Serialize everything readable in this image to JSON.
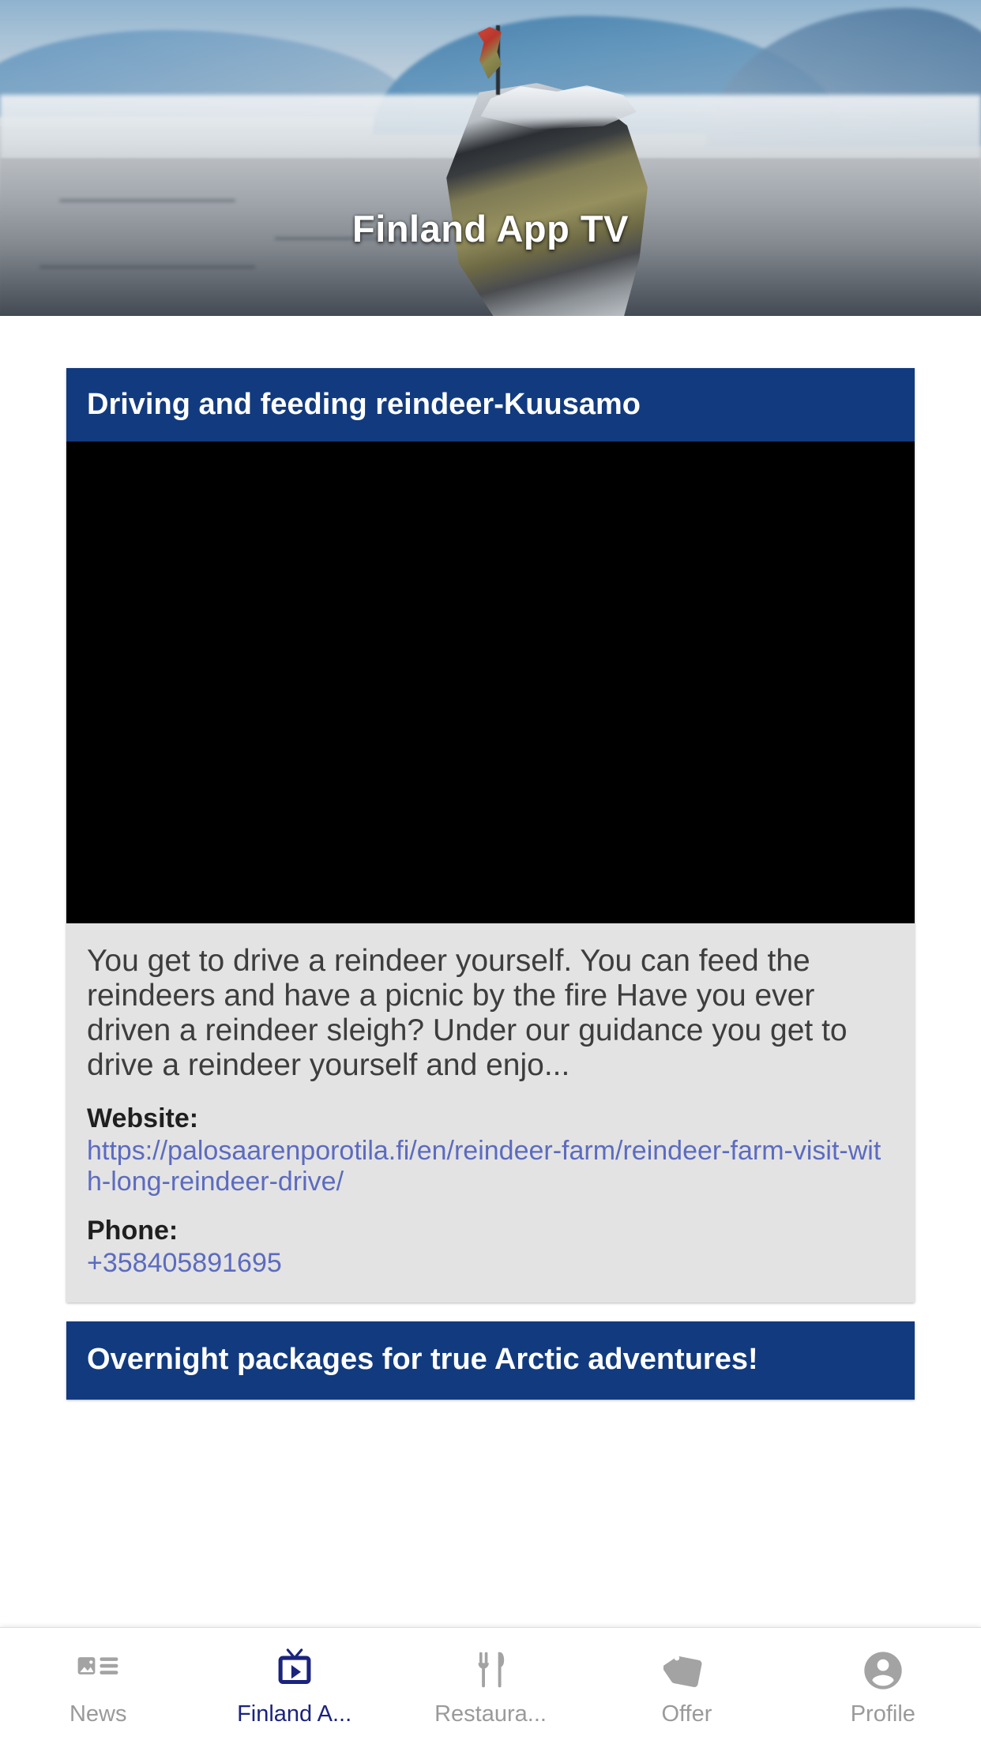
{
  "hero": {
    "title": "Finland App TV",
    "image_description": "snowy arctic landscape with rock cairn and flag"
  },
  "cards": [
    {
      "title": "Driving and feeding reindeer-Kuusamo",
      "media": "video-player",
      "description": "You get to drive a reindeer yourself. You can feed the reindeers and have a picnic by the fire  Have you ever driven a reindeer sleigh? Under our guidance you get to drive a reindeer yourself and enjo...",
      "website_label": "Website:",
      "website_url": "https://palosaarenporotila.fi/en/reindeer-farm/reindeer-farm-visit-with-long-reindeer-drive/",
      "phone_label": "Phone:",
      "phone_value": "+358405891695"
    },
    {
      "title": "Overnight packages for true Arctic adventures!"
    }
  ],
  "bottom_nav": {
    "items": [
      {
        "label": "News",
        "icon": "news-icon",
        "active": false
      },
      {
        "label": "Finland A...",
        "icon": "tv-play-icon",
        "active": true
      },
      {
        "label": "Restaura...",
        "icon": "restaurant-icon",
        "active": false
      },
      {
        "label": "Offer",
        "icon": "offer-tag-icon",
        "active": false
      },
      {
        "label": "Profile",
        "icon": "profile-icon",
        "active": false
      }
    ]
  },
  "colors": {
    "header_blue": "#123a7e",
    "card_body_gray": "#e3e3e3",
    "link_blue": "#5c6bc0",
    "nav_inactive": "#9a9a9a",
    "nav_active": "#1a237e",
    "video_black": "#000000"
  }
}
